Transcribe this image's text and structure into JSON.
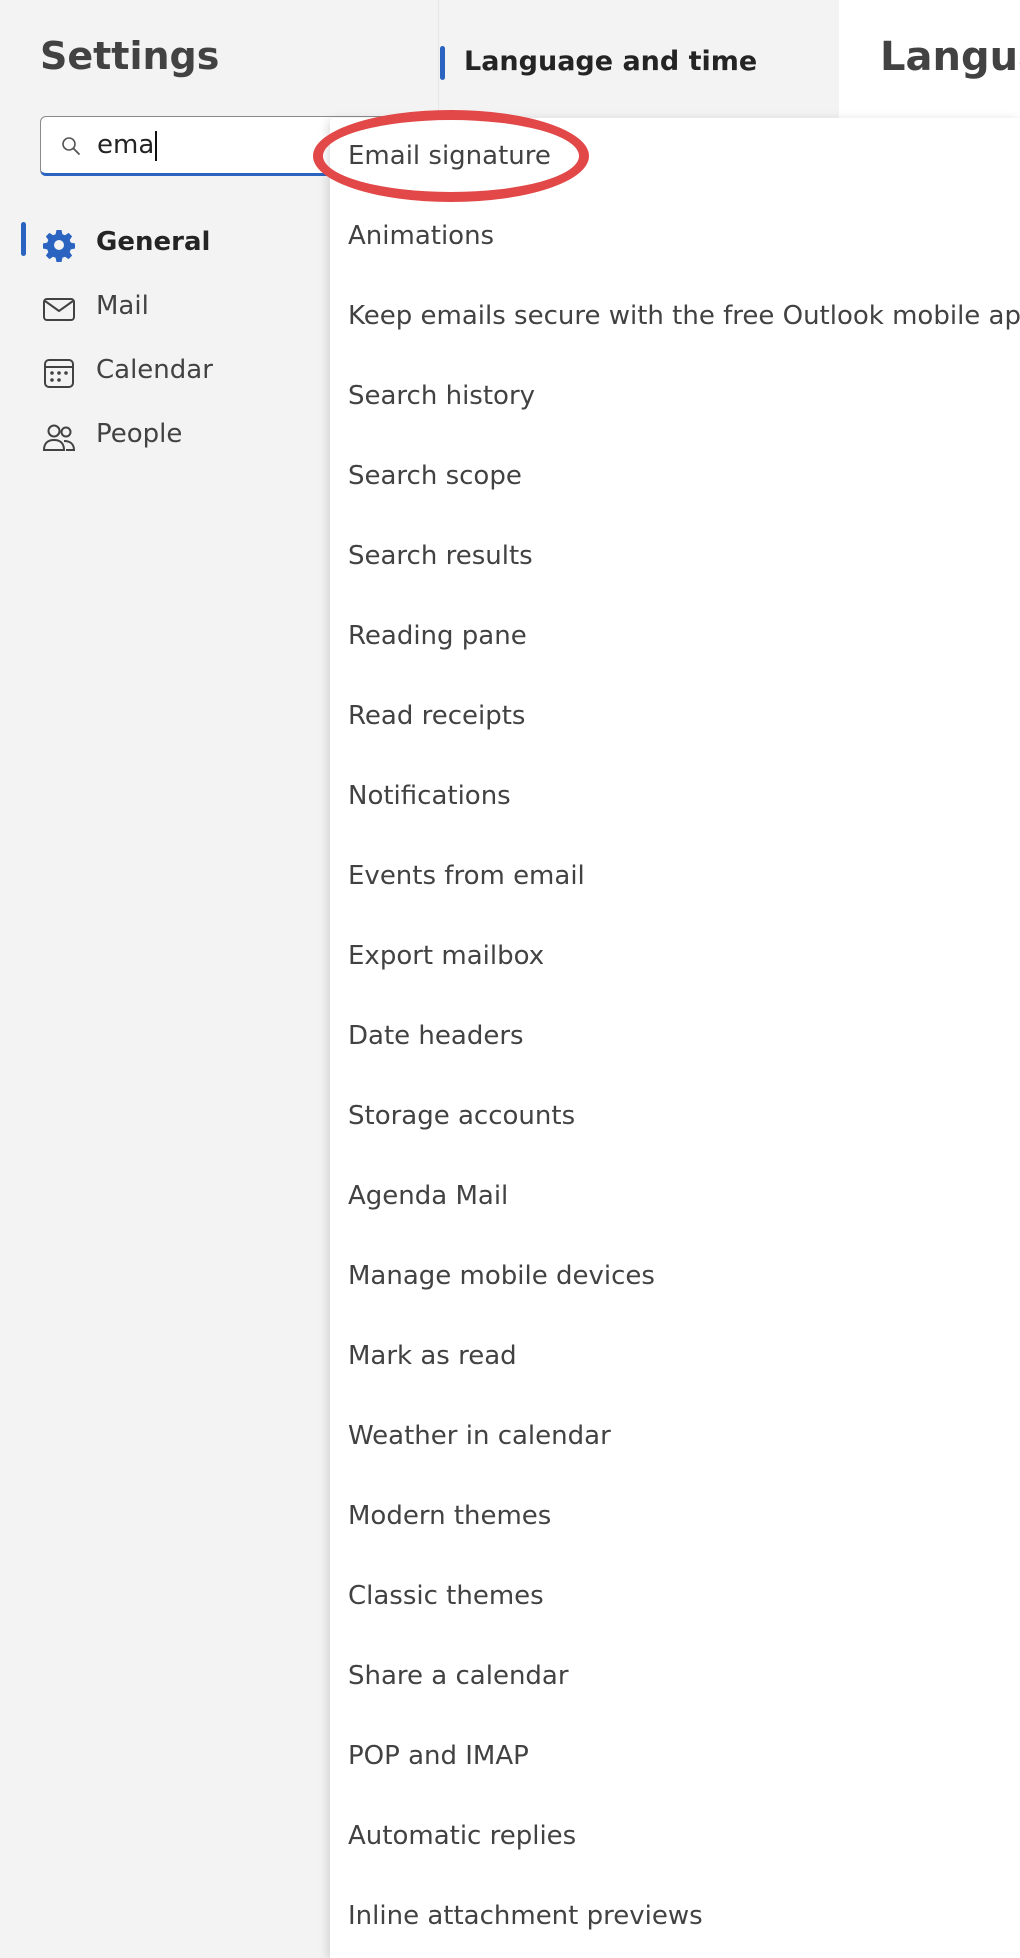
{
  "settings": {
    "title": "Settings",
    "search": {
      "value": "ema"
    }
  },
  "nav": {
    "items": [
      {
        "label": "General",
        "icon": "gear-icon",
        "selected": true
      },
      {
        "label": "Mail",
        "icon": "mail-icon",
        "selected": false
      },
      {
        "label": "Calendar",
        "icon": "calendar-icon",
        "selected": false
      },
      {
        "label": "People",
        "icon": "people-icon",
        "selected": false
      }
    ]
  },
  "middle_pane": {
    "selected_item": "Language and time"
  },
  "right_pane": {
    "title": "Langua"
  },
  "search_results": [
    "Email signature",
    "Animations",
    "Keep emails secure with the free Outlook mobile app",
    "Search history",
    "Search scope",
    "Search results",
    "Reading pane",
    "Read receipts",
    "Notifications",
    "Events from email",
    "Export mailbox",
    "Date headers",
    "Storage accounts",
    "Agenda Mail",
    "Manage mobile devices",
    "Mark as read",
    "Weather in calendar",
    "Modern themes",
    "Classic themes",
    "Share a calendar",
    "POP and IMAP",
    "Automatic replies",
    "Inline attachment previews"
  ],
  "colors": {
    "accent": "#2b63c1",
    "annotation_ring": "#e24848",
    "pane_background": "#f3f3f3"
  }
}
